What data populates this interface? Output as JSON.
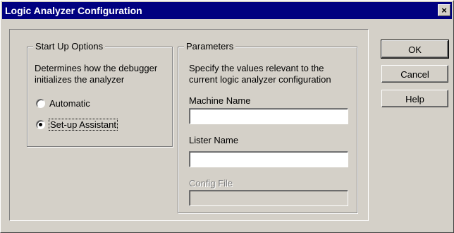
{
  "window": {
    "title": "Logic Analyzer Configuration",
    "close_glyph": "×"
  },
  "startup": {
    "group_label": "Start Up Options",
    "description_line1": "Determines how the debugger",
    "description_line2": "initializes the analyzer",
    "options": [
      {
        "label": "Automatic",
        "checked": false
      },
      {
        "label": "Set-up Assistant",
        "checked": true
      }
    ]
  },
  "parameters": {
    "group_label": "Parameters",
    "description_line1": "Specify the values relevant to the",
    "description_line2": "current logic analyzer configuration",
    "machine_name_label": "Machine Name",
    "machine_name_value": "",
    "lister_name_label": "Lister Name",
    "lister_name_value": "",
    "config_file_label": "Config File",
    "config_file_value": "",
    "config_file_enabled": false
  },
  "buttons": {
    "ok": "OK",
    "cancel": "Cancel",
    "help": "Help"
  }
}
